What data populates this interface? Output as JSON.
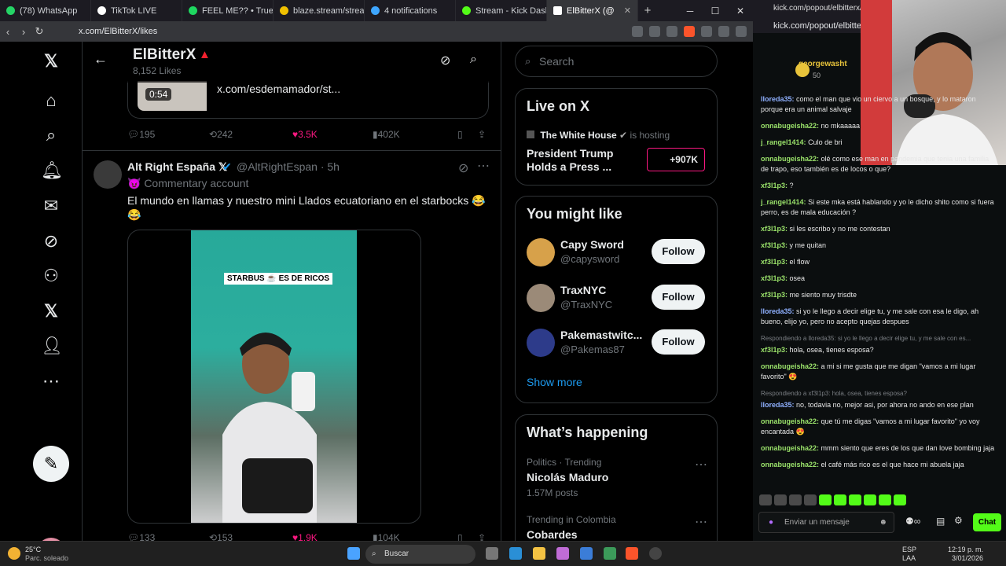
{
  "browser": {
    "tabs": [
      {
        "label": "(78) WhatsApp",
        "color": "#25d366"
      },
      {
        "label": "TikTok LIVE",
        "color": "#ffffff"
      },
      {
        "label": "FEEL ME?? • Trueno",
        "color": "#1ed760"
      },
      {
        "label": "blaze.stream/stream-se",
        "color": "#f0c000"
      },
      {
        "label": "4 notifications",
        "color": "#3ea6ff"
      },
      {
        "label": "Stream - Kick Dashboa",
        "color": "#53fc18"
      },
      {
        "label": "ElBitterX (@",
        "color": "#ffffff"
      }
    ],
    "url": "x.com/ElBitterX/likes"
  },
  "x": {
    "header": {
      "name": "ElBitterX",
      "likes": "8,152 Likes"
    },
    "prev_post": {
      "duration": "0:54",
      "link": "x.com/esdemamador/st...",
      "stats": {
        "replies": "195",
        "reposts": "242",
        "likes": "3.5K",
        "views": "402K"
      }
    },
    "tweet": {
      "name": "Alt Right España 𝕏",
      "handle": "@AltRightEspan · 5h",
      "badge": "😈 Commentary account",
      "text": "El mundo en llamas y nuestro mini Llados ecuatoriano en el starbocks 😂 😂",
      "video_caption": "STARBUS ☕ ES DE RICOS",
      "stats": {
        "replies": "133",
        "reposts": "153",
        "likes": "1.9K",
        "views": "104K"
      }
    },
    "sidebar": {
      "search_placeholder": "Search",
      "live": {
        "title": "Live on X",
        "host": "The White House",
        "host_suffix": "is hosting",
        "stream_title": "President Trump Holds a Press ...",
        "pill": "+907K"
      },
      "wtf": {
        "title": "You might like",
        "follow_label": "Follow",
        "accounts": [
          {
            "name": "Capy Sword",
            "handle": "@capysword",
            "color": "#d7a14a"
          },
          {
            "name": "TraxNYC",
            "handle": "@TraxNYC",
            "color": "#9b8a78"
          },
          {
            "name": "Pakemastwitc...",
            "handle": "@Pakemas87",
            "color": "#2d3b8a"
          }
        ],
        "show_more": "Show more"
      },
      "happening": {
        "title": "What’s happening",
        "trends": [
          {
            "context": "Politics · Trending",
            "topic": "Nicolás Maduro",
            "count": "1.57M posts"
          },
          {
            "context": "Trending in Colombia",
            "topic": "Cobardes",
            "count": ""
          }
        ]
      }
    }
  },
  "chat": {
    "url": "kick.com/popout/elbitterx/chat - K",
    "url2": "kick.com/popout/elbitterx/",
    "pinned_user": "georgewasht",
    "pinned_count": "50",
    "messages": [
      {
        "user": "lloreda35:",
        "color": "#8fb0ff",
        "text": "como el man que vio un ciervo a un bosque, y lo mataron porque era un animal salvaje"
      },
      {
        "user": "onnabugeisha22:",
        "color": "#9be36b",
        "text": "no mkaaaaa"
      },
      {
        "user": "j_rangel1414:",
        "color": "#9be36b",
        "text": "Culo de bri"
      },
      {
        "user": "onnabugeisha22:",
        "color": "#9be36b",
        "text": "olé como ese man en pandemia que tenia una familia de trapo, eso también es de locos o que?"
      },
      {
        "user": "xf3l1p3:",
        "color": "#9be36b",
        "text": "?"
      },
      {
        "user": "j_rangel1414:",
        "color": "#9be36b",
        "text": "Si este mka está hablando y yo le dicho shito como si fuera perro, es de mala educación ?"
      },
      {
        "user": "xf3l1p3:",
        "color": "#9be36b",
        "text": "si les escribo y no me contestan"
      },
      {
        "user": "xf3l1p3:",
        "color": "#9be36b",
        "text": "y me quitan"
      },
      {
        "user": "xf3l1p3:",
        "color": "#9be36b",
        "text": "el flow"
      },
      {
        "user": "xf3l1p3:",
        "color": "#9be36b",
        "text": "osea"
      },
      {
        "user": "xf3l1p3:",
        "color": "#9be36b",
        "text": "me siento muy trisdte"
      },
      {
        "user": "lloreda35:",
        "color": "#8fb0ff",
        "text": "si yo le llego a decir elige tu, y me sale con esa le digo, ah bueno, elijo yo, pero no acepto quejas despues"
      },
      {
        "reply": "Respondiendo a lloreda35: si yo le llego a decir elige tu, y me sale con es...",
        "user": "xf3l1p3:",
        "color": "#9be36b",
        "text": "hola, osea, tienes esposa?"
      },
      {
        "user": "onnabugeisha22:",
        "color": "#9be36b",
        "text": "a mi si me gusta que me digan \"vamos a mi lugar favorito\" 😍"
      },
      {
        "reply": "Respondiendo a xf3l1p3: hola, osea, tienes esposa?",
        "user": "lloreda35:",
        "color": "#8fb0ff",
        "text": "no, todavia no, mejor asi, por ahora no ando en ese plan"
      },
      {
        "user": "onnabugeisha22:",
        "color": "#9be36b",
        "text": "que tú me digas \"vamos a mi lugar favorito\" yo voy encantada 😍"
      },
      {
        "user": "onnabugeisha22:",
        "color": "#9be36b",
        "text": "mmm siento que eres de los que dan love bombing jaja"
      },
      {
        "user": "onnabugeisha22:",
        "color": "#9be36b",
        "text": "el café más rico es el que hace mi abuela jaja"
      }
    ],
    "input_placeholder": "Enviar un mensaje",
    "send_label": "Chat"
  },
  "taskbar": {
    "weather_temp": "25°C",
    "weather_desc": "Parc. soleado",
    "search": "Buscar",
    "lang1": "ESP",
    "lang2": "LAA",
    "time": "12:19 p. m.",
    "date": "3/01/2026"
  }
}
